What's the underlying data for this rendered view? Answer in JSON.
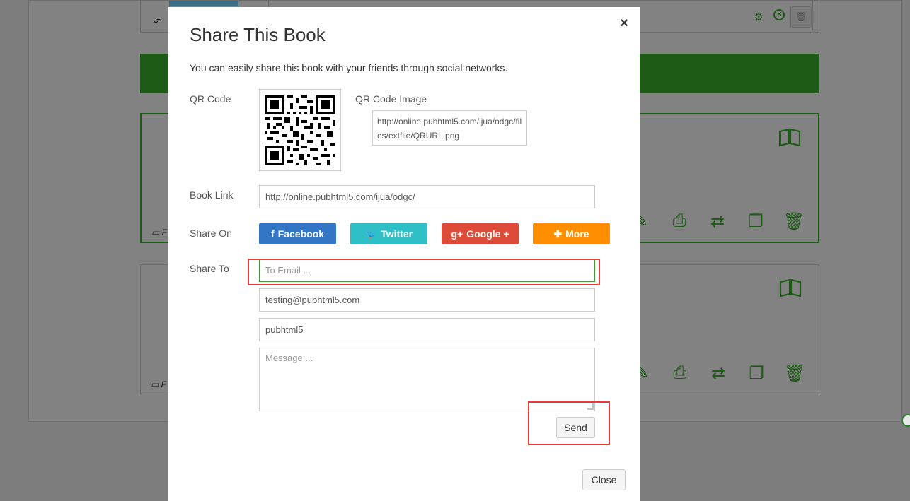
{
  "modal": {
    "title": "Share This Book",
    "close_glyph": "×",
    "description": "You can easily share this book with your friends through social networks.",
    "qr": {
      "label": "QR Code",
      "image_label": "QR Code Image",
      "image_url": "http://online.pubhtml5.com/ijua/odgc/files/extfile/QRURL.png"
    },
    "book_link": {
      "label": "Book Link",
      "value": "http://online.pubhtml5.com/ijua/odgc/"
    },
    "share_on": {
      "label": "Share On",
      "buttons": [
        {
          "icon": "f",
          "label": "Facebook",
          "color": "#3476c6"
        },
        {
          "icon": "🐦",
          "label": "Twitter",
          "color": "#2ebfc7"
        },
        {
          "icon": "g+",
          "label": "Google +",
          "color": "#dd4b39"
        },
        {
          "icon": "✚",
          "label": "More",
          "color": "#ff8f00"
        }
      ]
    },
    "share_to": {
      "label": "Share To",
      "to_email_placeholder": "To Email ...",
      "from_email": "testing@pubhtml5.com",
      "name": "pubhtml5",
      "message_placeholder": "Message ..."
    },
    "send_label": "Send",
    "close_label": "Close"
  },
  "background": {
    "accent_color": "#1d5b16",
    "tool_icons": [
      "edit-icon",
      "print-icon",
      "transfer-icon",
      "copy-icon",
      "trash-icon"
    ]
  },
  "highlights": {
    "color": "#e83a3a"
  }
}
